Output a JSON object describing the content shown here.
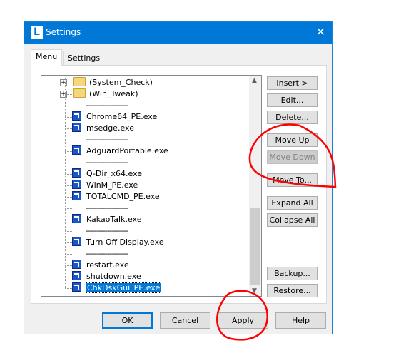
{
  "window": {
    "title": "Settings",
    "logo": "L",
    "close": "✕"
  },
  "tabs": [
    {
      "label": "Menu",
      "active": true
    },
    {
      "label": "Settings",
      "active": false
    }
  ],
  "tree": [
    {
      "type": "folder",
      "label": "(System_Check)"
    },
    {
      "type": "folder",
      "label": "(Win_Tweak)"
    },
    {
      "type": "sep",
      "label": "--------------------"
    },
    {
      "type": "exe",
      "label": "Chrome64_PE.exe"
    },
    {
      "type": "exe",
      "label": "msedge.exe"
    },
    {
      "type": "sep",
      "label": "--------------------"
    },
    {
      "type": "exe",
      "label": "AdguardPortable.exe"
    },
    {
      "type": "sep",
      "label": "--------------------"
    },
    {
      "type": "exe",
      "label": "Q-Dir_x64.exe"
    },
    {
      "type": "exe",
      "label": "WinM_PE.exe"
    },
    {
      "type": "exe",
      "label": "TOTALCMD_PE.exe"
    },
    {
      "type": "sep",
      "label": "--------------------"
    },
    {
      "type": "exe",
      "label": "KakaoTalk.exe"
    },
    {
      "type": "sep",
      "label": "--------------------"
    },
    {
      "type": "exe",
      "label": "Turn Off Display.exe"
    },
    {
      "type": "sep",
      "label": "--------------------"
    },
    {
      "type": "exe",
      "label": "restart.exe"
    },
    {
      "type": "exe",
      "label": "shutdown.exe"
    },
    {
      "type": "exe",
      "label": "ChkDskGui_PE.exe",
      "selected": true
    }
  ],
  "side_buttons": [
    {
      "label": "Insert >"
    },
    {
      "label": "Edit..."
    },
    {
      "label": "Delete..."
    },
    {
      "label": "Move Up"
    },
    {
      "label": "Move Down",
      "disabled": true
    },
    {
      "label": "Move To..."
    },
    {
      "label": "Expand All"
    },
    {
      "label": "Collapse All"
    },
    {
      "label": "Backup..."
    },
    {
      "label": "Restore..."
    }
  ],
  "bottom_buttons": [
    {
      "label": "OK"
    },
    {
      "label": "Cancel"
    },
    {
      "label": "Apply"
    },
    {
      "label": "Help"
    }
  ],
  "colors": {
    "titlebar": "#0078d7",
    "selection": "#0078d7",
    "annotation": "#ff0000"
  }
}
